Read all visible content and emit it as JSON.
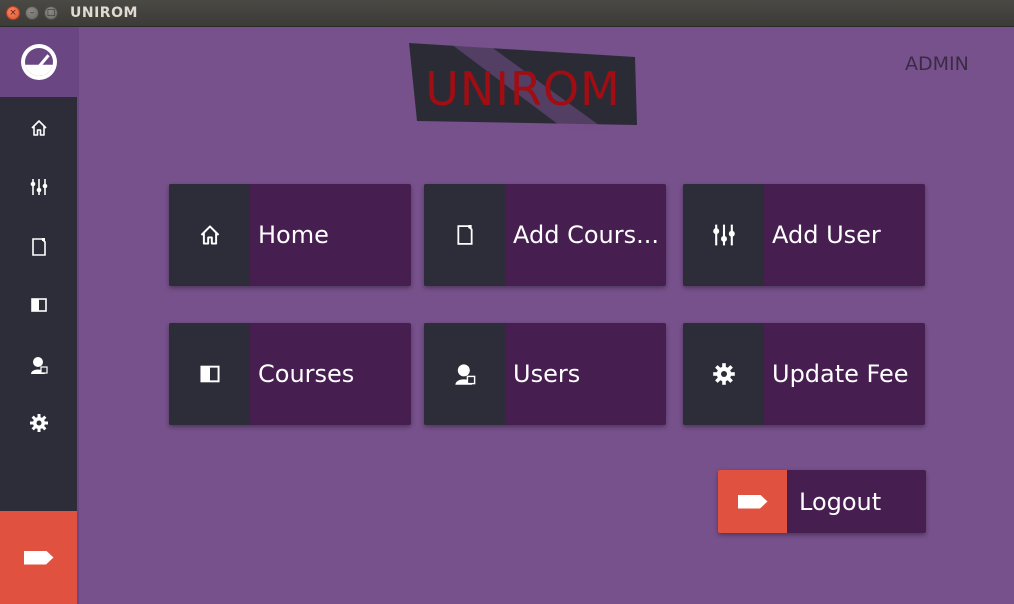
{
  "window": {
    "title": "UNIROM"
  },
  "header": {
    "user_label": "ADMIN",
    "logo_text": "UNIROM"
  },
  "sidebar": {
    "items": [
      {
        "icon": "home-icon"
      },
      {
        "icon": "sliders-icon"
      },
      {
        "icon": "add-course-icon"
      },
      {
        "icon": "courses-icon"
      },
      {
        "icon": "users-icon"
      },
      {
        "icon": "gear-icon"
      }
    ],
    "logout_icon": "tag-icon"
  },
  "tiles": [
    {
      "label": "Home",
      "icon": "home-icon"
    },
    {
      "label": "Add Cours...",
      "icon": "add-course-icon"
    },
    {
      "label": "Add User",
      "icon": "sliders-icon"
    },
    {
      "label": "Courses",
      "icon": "courses-icon"
    },
    {
      "label": "Users",
      "icon": "users-icon"
    },
    {
      "label": "Update Fee",
      "icon": "gear-icon"
    }
  ],
  "logout": {
    "label": "Logout",
    "icon": "tag-icon"
  },
  "colors": {
    "main_bg": "#77518b",
    "sidebar_bg": "#2d2d3a",
    "tile_bg": "#461e50",
    "accent_red": "#e05140",
    "logo_red": "#a00d12"
  }
}
